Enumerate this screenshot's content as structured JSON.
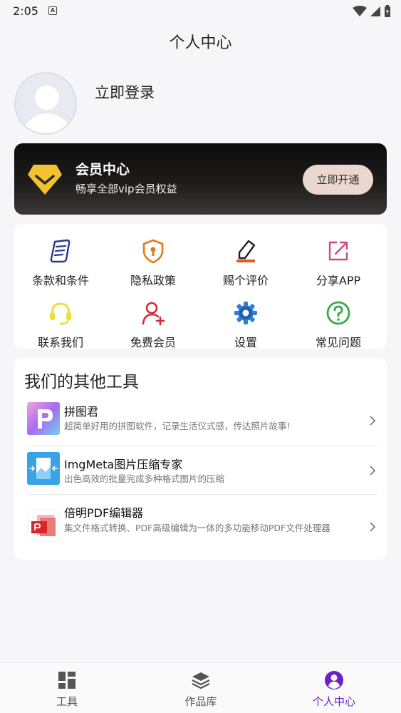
{
  "status_bar": {
    "time": "2:05",
    "notification_icon": "A"
  },
  "header": {
    "title": "个人中心"
  },
  "profile": {
    "login_label": "立即登录"
  },
  "vip": {
    "title": "会员中心",
    "subtitle": "畅享全部vip会员权益",
    "button": "立即开通",
    "accent": "#f2c230"
  },
  "grid": [
    {
      "label": "条款和条件",
      "icon": "document-icon",
      "color": "#2a3a8a"
    },
    {
      "label": "隐私政策",
      "icon": "shield-lock-icon",
      "color": "#e07b1c"
    },
    {
      "label": "赐个评价",
      "icon": "pencil-icon",
      "color": "#e35a1c"
    },
    {
      "label": "分享APP",
      "icon": "share-icon",
      "color": "#d04a7a"
    },
    {
      "label": "联系我们",
      "icon": "headset-icon",
      "color": "#f0dc3c"
    },
    {
      "label": "免费会员",
      "icon": "add-user-icon",
      "color": "#d8283a"
    },
    {
      "label": "设置",
      "icon": "gear-icon",
      "color": "#2f7fd8"
    },
    {
      "label": "常见问题",
      "icon": "question-icon",
      "color": "#3aa84a"
    }
  ],
  "tools": {
    "heading": "我们的其他工具",
    "items": [
      {
        "title": "拼图君",
        "desc": "超简单好用的拼图软件，记录生活仪式感，传达照片故事!"
      },
      {
        "title": "ImgMeta图片压缩专家",
        "desc": "出色高效的批量完成多种格式图片的压缩"
      },
      {
        "title": "倍明PDF编辑器",
        "desc": "集文件格式转换、PDF高级编辑为一体的多功能移动PDF文件处理器"
      }
    ]
  },
  "bottom_nav": [
    {
      "label": "工具",
      "icon": "grid-icon"
    },
    {
      "label": "作品库",
      "icon": "layers-icon"
    },
    {
      "label": "个人中心",
      "icon": "person-icon",
      "active": true
    }
  ],
  "colors": {
    "active": "#6b21c8",
    "background": "#f6f6f8"
  }
}
